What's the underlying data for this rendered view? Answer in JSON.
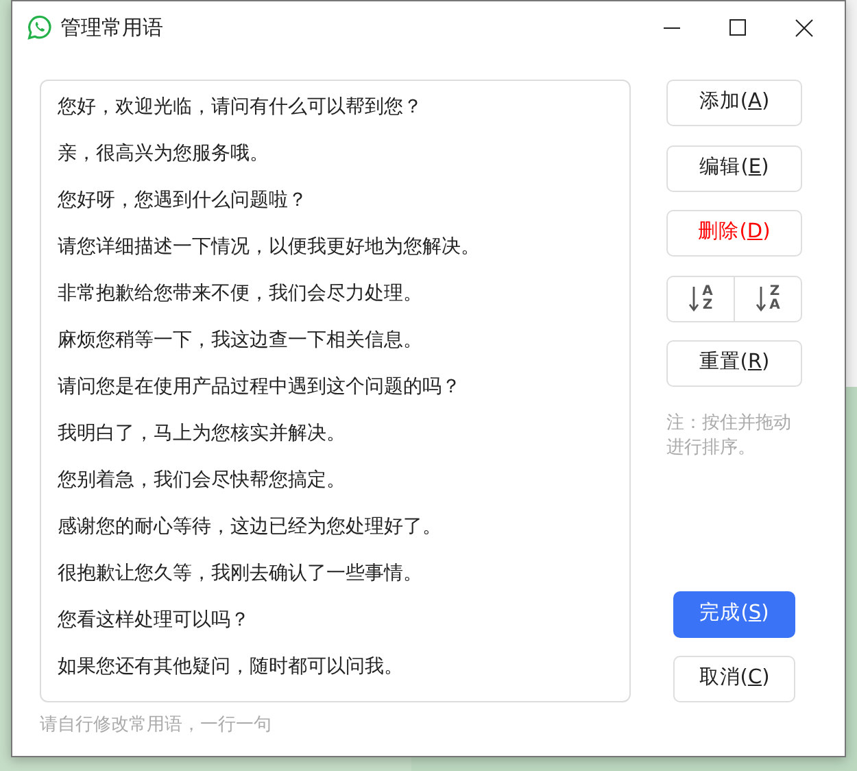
{
  "window": {
    "title": "管理常用语"
  },
  "phrases": [
    "您好，欢迎光临，请问有什么可以帮到您？",
    "亲，很高兴为您服务哦。",
    "您好呀，您遇到什么问题啦？",
    "请您详细描述一下情况，以便我更好地为您解决。",
    "非常抱歉给您带来不便，我们会尽力处理。",
    "麻烦您稍等一下，我这边查一下相关信息。",
    "请问您是在使用产品过程中遇到这个问题的吗？",
    "我明白了，马上为您核实并解决。",
    "您别着急，我们会尽快帮您搞定。",
    "感谢您的耐心等待，这边已经为您处理好了。",
    "很抱歉让您久等，我刚去确认了一些事情。",
    "您看这样处理可以吗？",
    "如果您还有其他疑问，随时都可以问我。"
  ],
  "hint": "请自行修改常用语，一行一句",
  "buttons": [
    {
      "kind": "normal",
      "before": "添加(",
      "mnemonic": "A",
      "after": ")"
    },
    {
      "kind": "normal",
      "before": "编辑(",
      "mnemonic": "E",
      "after": ")"
    },
    {
      "kind": "danger",
      "before": "删除(",
      "mnemonic": "D",
      "after": ")"
    },
    {
      "kind": "sort",
      "sorts": [
        {
          "top": "A",
          "bottom": "Z"
        },
        {
          "top": "Z",
          "bottom": "A"
        }
      ]
    },
    {
      "kind": "normal",
      "before": "重置(",
      "mnemonic": "R",
      "after": ")"
    }
  ],
  "note": "注：按住并拖动进行排序。",
  "footer_buttons": [
    {
      "kind": "primary",
      "before": "完成(",
      "mnemonic": "S",
      "after": ")"
    },
    {
      "kind": "normal",
      "before": "取消(",
      "mnemonic": "C",
      "after": ")"
    }
  ]
}
